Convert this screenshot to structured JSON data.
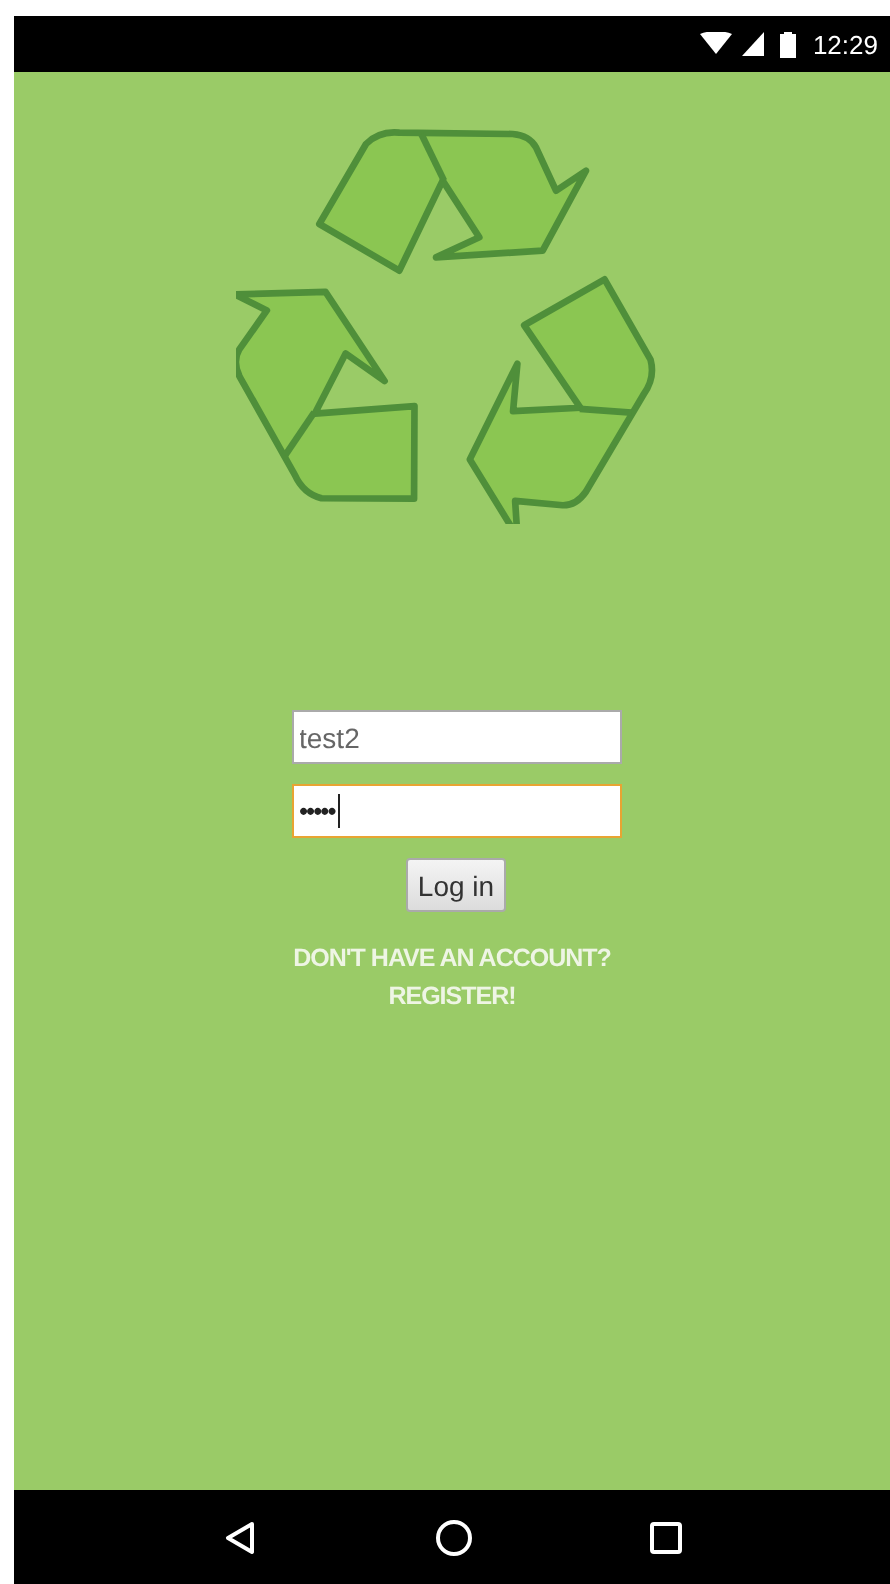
{
  "status_bar": {
    "time": "12:29"
  },
  "login": {
    "username": {
      "value": "test2",
      "focused": false
    },
    "password": {
      "value": "•••••",
      "focused": true
    },
    "button": "Log in",
    "register_link": {
      "lines": [
        "DON'T HAVE AN ACCOUNT?",
        "REGISTER!"
      ]
    }
  },
  "nav_bar": {
    "buttons": [
      {
        "kind": "back"
      },
      {
        "kind": "home"
      },
      {
        "kind": "recents"
      }
    ]
  }
}
